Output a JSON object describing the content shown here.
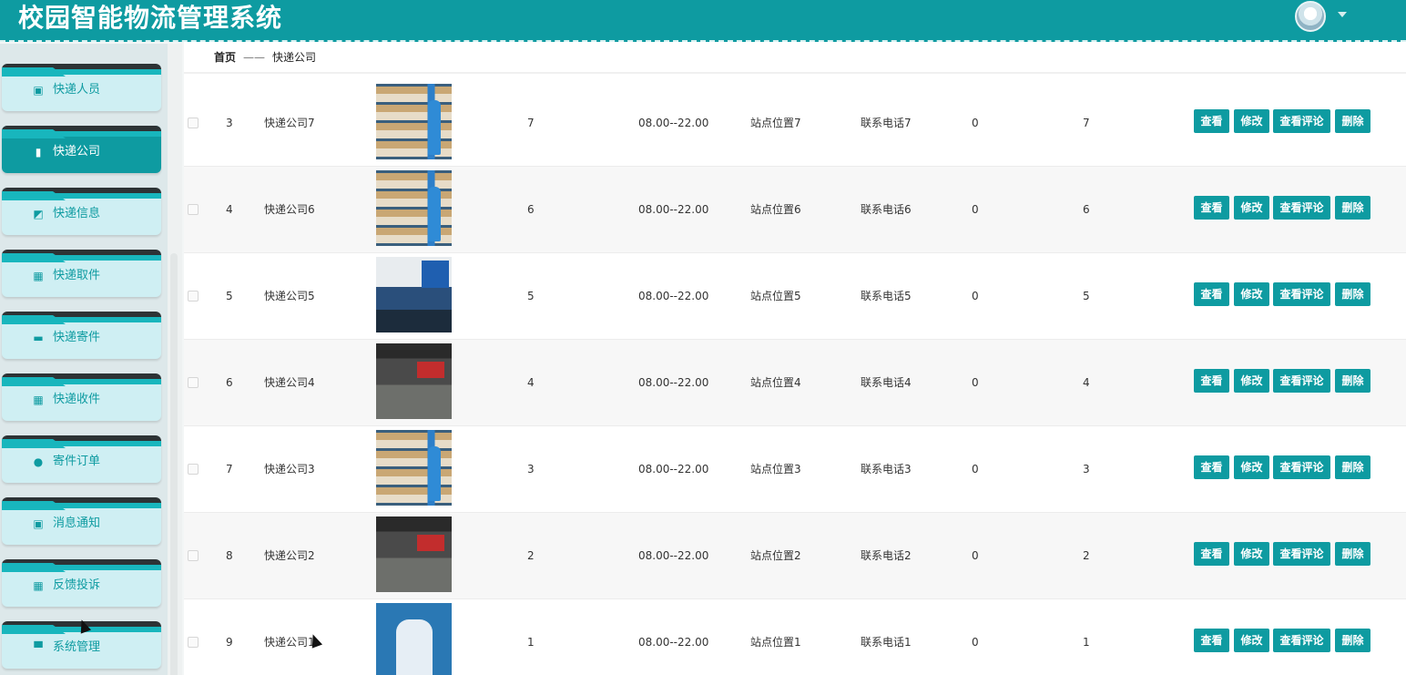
{
  "header": {
    "title": "校园智能物流管理系统"
  },
  "sidebar": {
    "items": [
      {
        "label": "快递人员",
        "icon": "id-card-icon",
        "glyph": "▣",
        "active": false
      },
      {
        "label": "快递公司",
        "icon": "bar-chart-icon",
        "glyph": "▮",
        "active": true
      },
      {
        "label": "快递信息",
        "icon": "line-chart-icon",
        "glyph": "◩",
        "active": false
      },
      {
        "label": "快递取件",
        "icon": "grid-icon",
        "glyph": "▦",
        "active": false
      },
      {
        "label": "快递寄件",
        "icon": "ticket-icon",
        "glyph": "▬",
        "active": false
      },
      {
        "label": "快递收件",
        "icon": "grid-icon",
        "glyph": "▦",
        "active": false
      },
      {
        "label": "寄件订单",
        "icon": "pin-icon",
        "glyph": "●",
        "active": false
      },
      {
        "label": "消息通知",
        "icon": "clipboard-check-icon",
        "glyph": "▣",
        "active": false
      },
      {
        "label": "反馈投诉",
        "icon": "grid-icon",
        "glyph": "▦",
        "active": false
      },
      {
        "label": "系统管理",
        "icon": "printer-icon",
        "glyph": "▀",
        "active": false
      }
    ]
  },
  "breadcrumb": {
    "home": "首页",
    "sep": "——",
    "current": "快递公司"
  },
  "actions": {
    "view": "查看",
    "edit": "修改",
    "review": "查看评论",
    "delete": "删除"
  },
  "table": {
    "rows": [
      {
        "index": "3",
        "name": "快递公司7",
        "image": "shelf",
        "value": "7",
        "hours": "08.00--22.00",
        "location": "站点位置7",
        "phone": "联系电话7",
        "count_a": "0",
        "count_b": "7"
      },
      {
        "index": "4",
        "name": "快递公司6",
        "image": "shelf",
        "value": "6",
        "hours": "08.00--22.00",
        "location": "站点位置6",
        "phone": "联系电话6",
        "count_a": "0",
        "count_b": "6"
      },
      {
        "index": "5",
        "name": "快递公司5",
        "image": "counter",
        "value": "5",
        "hours": "08.00--22.00",
        "location": "站点位置5",
        "phone": "联系电话5",
        "count_a": "0",
        "count_b": "5"
      },
      {
        "index": "6",
        "name": "快递公司4",
        "image": "hall",
        "value": "4",
        "hours": "08.00--22.00",
        "location": "站点位置4",
        "phone": "联系电话4",
        "count_a": "0",
        "count_b": "4"
      },
      {
        "index": "7",
        "name": "快递公司3",
        "image": "shelf",
        "value": "3",
        "hours": "08.00--22.00",
        "location": "站点位置3",
        "phone": "联系电话3",
        "count_a": "0",
        "count_b": "3"
      },
      {
        "index": "8",
        "name": "快递公司2",
        "image": "hall",
        "value": "2",
        "hours": "08.00--22.00",
        "location": "站点位置2",
        "phone": "联系电话2",
        "count_a": "0",
        "count_b": "2"
      },
      {
        "index": "9",
        "name": "快递公司1",
        "image": "person",
        "value": "1",
        "hours": "08.00--22.00",
        "location": "站点位置1",
        "phone": "联系电话1",
        "count_a": "0",
        "count_b": "1"
      }
    ]
  }
}
